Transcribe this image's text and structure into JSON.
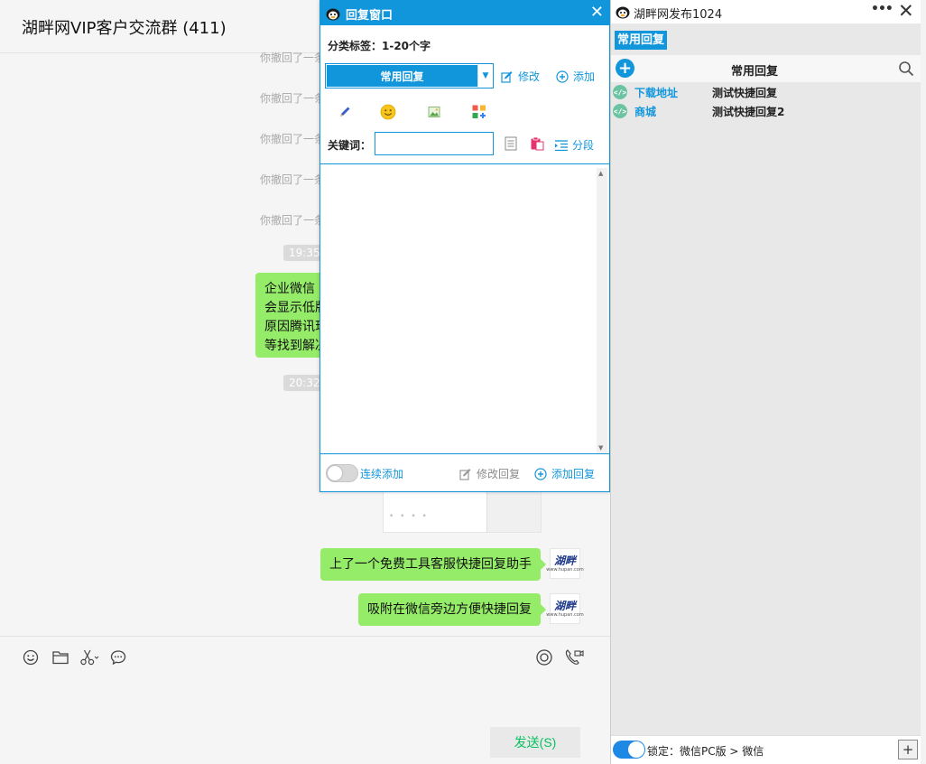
{
  "chat": {
    "title": "湖畔网VIP客户交流群 (411)",
    "recall_notices": [
      "你撤回了一条",
      "你撤回了一条",
      "你撤回了一条",
      "你撤回了一条",
      "你撤回了一条"
    ],
    "time_1": "19:35",
    "time_2": "20:32",
    "bubble_lines": [
      "企业微信",
      "会显示低版",
      "原因腾讯现",
      "等找到解决"
    ],
    "messages": [
      "上了一个免费工具客服快捷回复助手",
      "吸附在微信旁边方便快捷回复"
    ],
    "avatar_text": "湖畔",
    "avatar_sub": "www.hupan.com",
    "send_label": "发送(S)",
    "icons": [
      "emoji-icon",
      "folder-icon",
      "scissors-icon",
      "chat-bubble-icon",
      "live-icon",
      "video-call-icon"
    ]
  },
  "reply_window": {
    "title": "回复窗口",
    "close": "✕",
    "tag_label": "分类标签：1-20个字",
    "category_selected": "常用回复",
    "edit_label": "修改",
    "add_label": "添加",
    "keyword_label": "关键词：",
    "keyword_value": "",
    "segment_label": "分段",
    "continuous_label": "连续添加",
    "continuous_on": false,
    "modify_reply_label": "修改回复",
    "add_reply_label": "添加回复",
    "accent_color": "#1296db"
  },
  "right_panel": {
    "title": "湖畔网发布1024",
    "more": "•••",
    "close": "✕",
    "tab_label": "常用回复",
    "list_header": "常用回复",
    "items": [
      {
        "title": "下载地址",
        "text": "测试快捷回复"
      },
      {
        "title": "商城",
        "text": "测试快捷回复2"
      }
    ],
    "lock_text": "锁定：微信PC版 > 微信",
    "lock_on": true
  }
}
